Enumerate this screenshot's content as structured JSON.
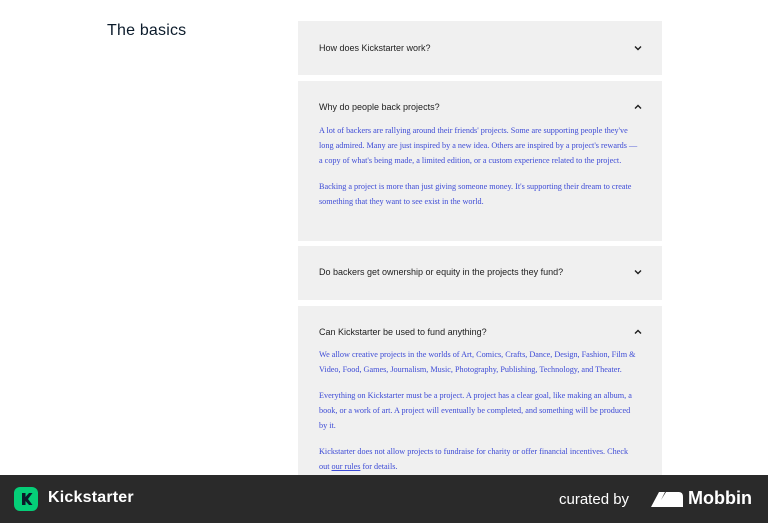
{
  "section": {
    "title": "The basics"
  },
  "faqs": [
    {
      "question": "How does Kickstarter work?",
      "expanded": false,
      "answer": []
    },
    {
      "question": "Why do people back projects?",
      "expanded": true,
      "answer": [
        "A lot of backers are rallying around their friends' projects. Some are supporting people they've long admired. Many are just inspired by a new idea. Others are inspired by a project's rewards — a copy of what's being made, a limited edition, or a custom experience related to the project.",
        "Backing a project is more than just giving someone money. It's supporting their dream to create something that they want to see exist in the world."
      ]
    },
    {
      "question": "Do backers get ownership or equity in the projects they fund?",
      "expanded": false,
      "answer": []
    },
    {
      "question": "Can Kickstarter be used to fund anything?",
      "expanded": true,
      "answer": [
        "We allow creative projects in the worlds of Art, Comics, Crafts, Dance, Design, Fashion, Film & Video, Food, Games, Journalism, Music, Photography, Publishing, Technology, and Theater.",
        "Everything on Kickstarter must be a project. A project has a clear goal, like making an album, a book, or a work of art. A project will eventually be completed, and something will be produced by it.",
        "Kickstarter does not allow projects to fundraise for charity or offer financial incentives. Check out"
      ],
      "link_text": "our rules",
      "link_suffix": " for details."
    }
  ],
  "footer": {
    "brand": "Kickstarter",
    "curated_by": "curated by",
    "curator": "Mobbin",
    "brand_color": "#05ce78"
  }
}
